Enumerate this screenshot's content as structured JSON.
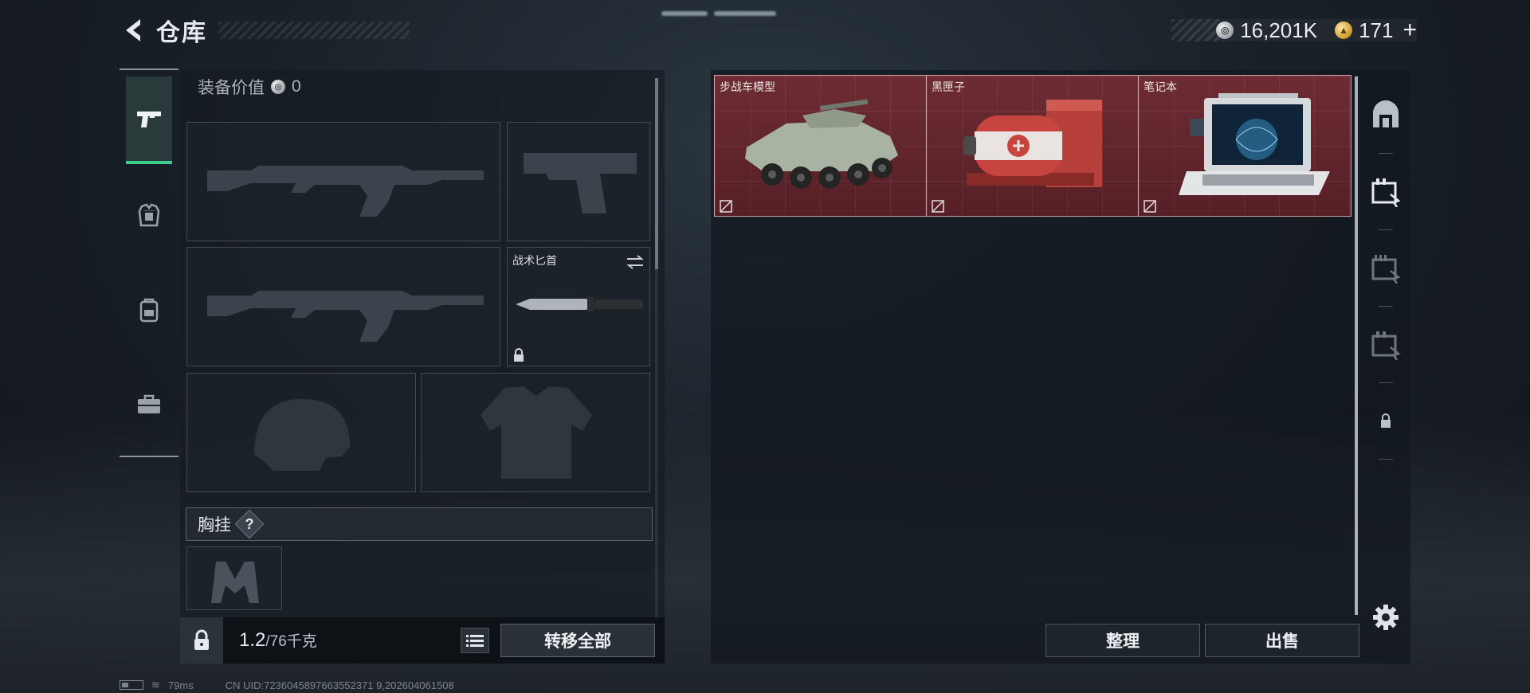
{
  "header": {
    "title": "仓库",
    "back_icon": "back-arrow-icon"
  },
  "currency": {
    "silver_value": "16,201K",
    "gold_value": "171",
    "plus": "+"
  },
  "categories": [
    {
      "name": "weapons",
      "icon": "pistol-icon",
      "active": true
    },
    {
      "name": "armor",
      "icon": "armor-vest-icon",
      "active": false
    },
    {
      "name": "backpack",
      "icon": "backpack-icon",
      "active": false
    },
    {
      "name": "toolkit",
      "icon": "briefcase-icon",
      "active": false
    }
  ],
  "equipment": {
    "value_label": "装备价值",
    "value": "0",
    "melee_slot_label": "战术匕首",
    "section_title": "胸挂",
    "help": "?",
    "weight_current": "1.2",
    "weight_max": "/76千克",
    "transfer_all": "转移全部"
  },
  "storage": {
    "items": [
      {
        "name": "步战车模型",
        "art": "ifv-model"
      },
      {
        "name": "黑匣子",
        "art": "black-box"
      },
      {
        "name": "笔记本",
        "art": "laptop"
      }
    ],
    "item_bg_color": "#5e242a",
    "sort_label": "整理",
    "sell_label": "出售"
  },
  "right_rail": {
    "icons": [
      "armory-icon",
      "stash-tab-1-icon",
      "stash-tab-2-icon",
      "stash-tab-3-icon",
      "locked-tab-icon"
    ],
    "settings_icon": "gear-icon"
  },
  "status": {
    "ping": "79ms",
    "uid": "CN UID:7236045897663552371 9,202604061508"
  },
  "colors": {
    "accent_green": "#3ecf8e",
    "item_border": "#c9a3a8"
  }
}
